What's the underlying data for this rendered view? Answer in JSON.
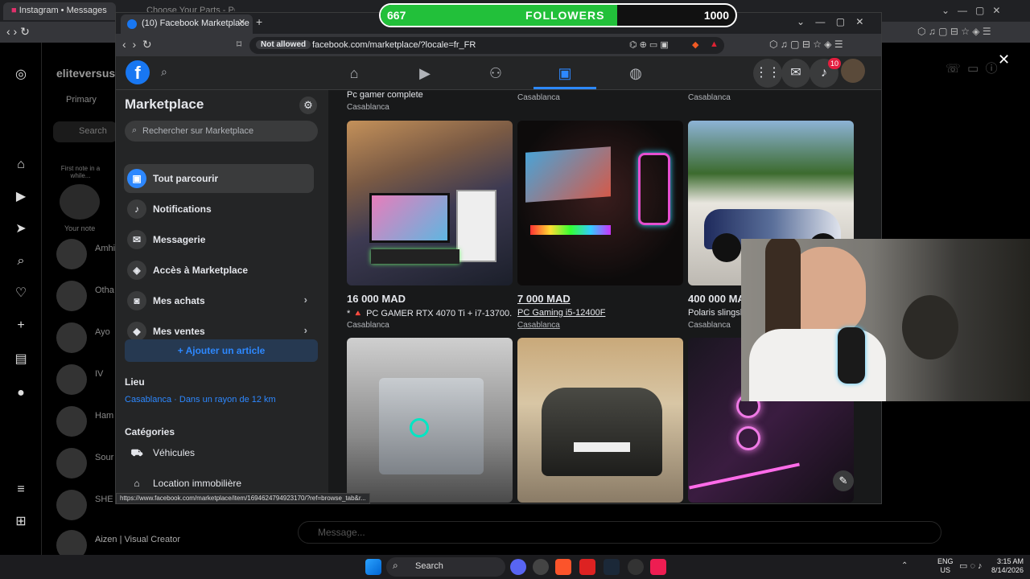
{
  "overlay": {
    "followers_current": "667",
    "followers_label": "FOLLOWERS",
    "followers_goal": "1000",
    "progress_fraction": 0.667,
    "fill_color": "#22c03a"
  },
  "bg_browser": {
    "tabs": [
      "Instagram • Messages",
      "Choose Your Parts - PCPartPicker"
    ],
    "instagram": {
      "username": "eliteversus",
      "tab_primary": "Primary",
      "search": "Search",
      "note_prompt": "First note in a while...",
      "your_note": "Your note",
      "threads": [
        "Amhi",
        "Otha",
        "Ayo",
        "IV",
        "Ham",
        "Sour",
        "SHE",
        "Aizen | Visual Creator"
      ],
      "message_placeholder": "Message..."
    }
  },
  "popup": {
    "tab_title": "(10) Facebook Marketplace | Fac",
    "addr_security": "Not allowed",
    "url": "facebook.com/marketplace/?locale=fr_FR",
    "notif_count": "10",
    "status_url": "https://www.facebook.com/marketplace/item/1694624794923170/?ref=browse_tab&r..."
  },
  "sidebar": {
    "title": "Marketplace",
    "search_placeholder": "Rechercher sur Marketplace",
    "items": [
      {
        "label": "Tout parcourir"
      },
      {
        "label": "Notifications"
      },
      {
        "label": "Messagerie"
      },
      {
        "label": "Accès à Marketplace"
      },
      {
        "label": "Mes achats"
      },
      {
        "label": "Mes ventes"
      }
    ],
    "add_article": "+ Ajouter un article",
    "location_heading": "Lieu",
    "location_value": "Casablanca · Dans un rayon de 12 km",
    "categories_heading": "Catégories",
    "categories": [
      "Véhicules",
      "Location immobilière"
    ]
  },
  "listings": {
    "top_row": [
      {
        "title": "Pc gamer complete",
        "location": "Casablanca"
      },
      {
        "title": "",
        "location": "Casablanca"
      },
      {
        "title": "",
        "location": "Casablanca"
      }
    ],
    "row1": [
      {
        "price": "16 000 MAD",
        "title": "* 🔺 PC GAMER RTX 4070 Ti + i7-13700...",
        "location": "Casablanca"
      },
      {
        "price": "7 000 MAD",
        "title": "PC Gaming i5-12400F",
        "location": "Casablanca"
      },
      {
        "price": "400 000 MAD",
        "title": "Polaris slingshot",
        "location": "Casablanca"
      }
    ]
  },
  "taskbar": {
    "search": "Search",
    "lang": "ENG",
    "region": "US",
    "time": "3:15 AM",
    "date": "8/14/2026"
  }
}
